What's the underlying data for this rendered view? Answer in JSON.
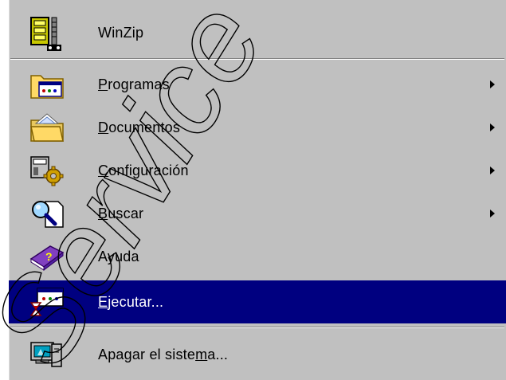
{
  "start_menu": {
    "items": [
      {
        "id": "winzip",
        "label": "WinZip",
        "mnemonic": "",
        "rest": "WinZip",
        "icon": "winzip-icon",
        "submenu": false
      },
      {
        "id": "programas",
        "label": "Programas",
        "mnemonic": "P",
        "rest": "rogramas",
        "icon": "programs-folder-icon",
        "submenu": true
      },
      {
        "id": "documentos",
        "label": "Documentos",
        "mnemonic": "D",
        "rest": "ocumentos",
        "icon": "documents-folder-icon",
        "submenu": true
      },
      {
        "id": "configuracion",
        "label": "Configuración",
        "mnemonic": "C",
        "rest": "onfiguración",
        "icon": "settings-icon",
        "submenu": true
      },
      {
        "id": "buscar",
        "label": "Buscar",
        "mnemonic": "B",
        "rest": "uscar",
        "icon": "find-icon",
        "submenu": true
      },
      {
        "id": "ayuda",
        "label": "Ayuda",
        "mnemonic": "",
        "rest": "Ayuda",
        "icon": "help-book-icon",
        "submenu": false
      },
      {
        "id": "ejecutar",
        "label": "Ejecutar...",
        "mnemonic": "E",
        "rest": "jecutar...",
        "icon": "run-icon",
        "submenu": false,
        "selected": true
      },
      {
        "id": "apagar",
        "label": "Apagar el sistema...",
        "pre": "Apagar el siste",
        "mnemonic": "m",
        "rest": "a...",
        "icon": "shutdown-icon",
        "submenu": false
      }
    ]
  },
  "watermark": {
    "text": "Service Ca"
  },
  "colors": {
    "menu_bg": "#c0c0c0",
    "highlight": "#000080",
    "highlight_text": "#ffffff"
  }
}
